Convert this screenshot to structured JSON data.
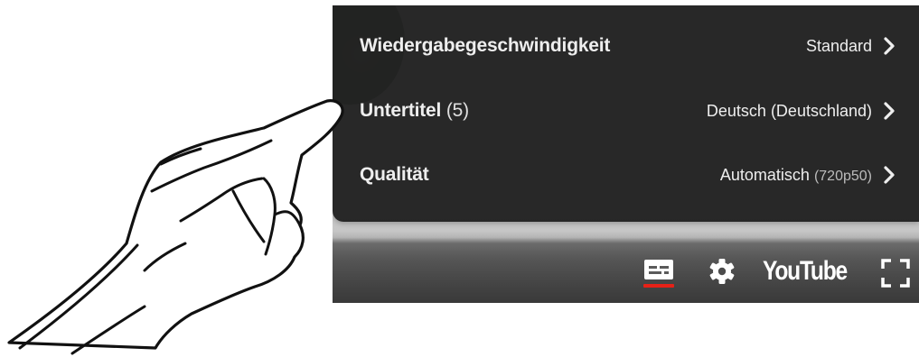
{
  "settings_menu": {
    "items": [
      {
        "label": "Wiedergabegeschwindigkeit",
        "count": "",
        "value": "Standard",
        "value_sub": ""
      },
      {
        "label": "Untertitel",
        "count": "(5)",
        "value": "Deutsch (Deutschland)",
        "value_sub": ""
      },
      {
        "label": "Qualität",
        "count": "",
        "value": "Automatisch",
        "value_sub": "(720p50)"
      }
    ]
  },
  "controls": {
    "subtitles_active": true,
    "logo_text": "YouTube"
  },
  "colors": {
    "menu_bg": "#222222",
    "accent_red": "#e62117",
    "text": "#eeeeee"
  },
  "icons": [
    "chevron-right-icon",
    "subtitles-icon",
    "gear-icon",
    "fullscreen-icon",
    "pointing-hand-icon"
  ]
}
